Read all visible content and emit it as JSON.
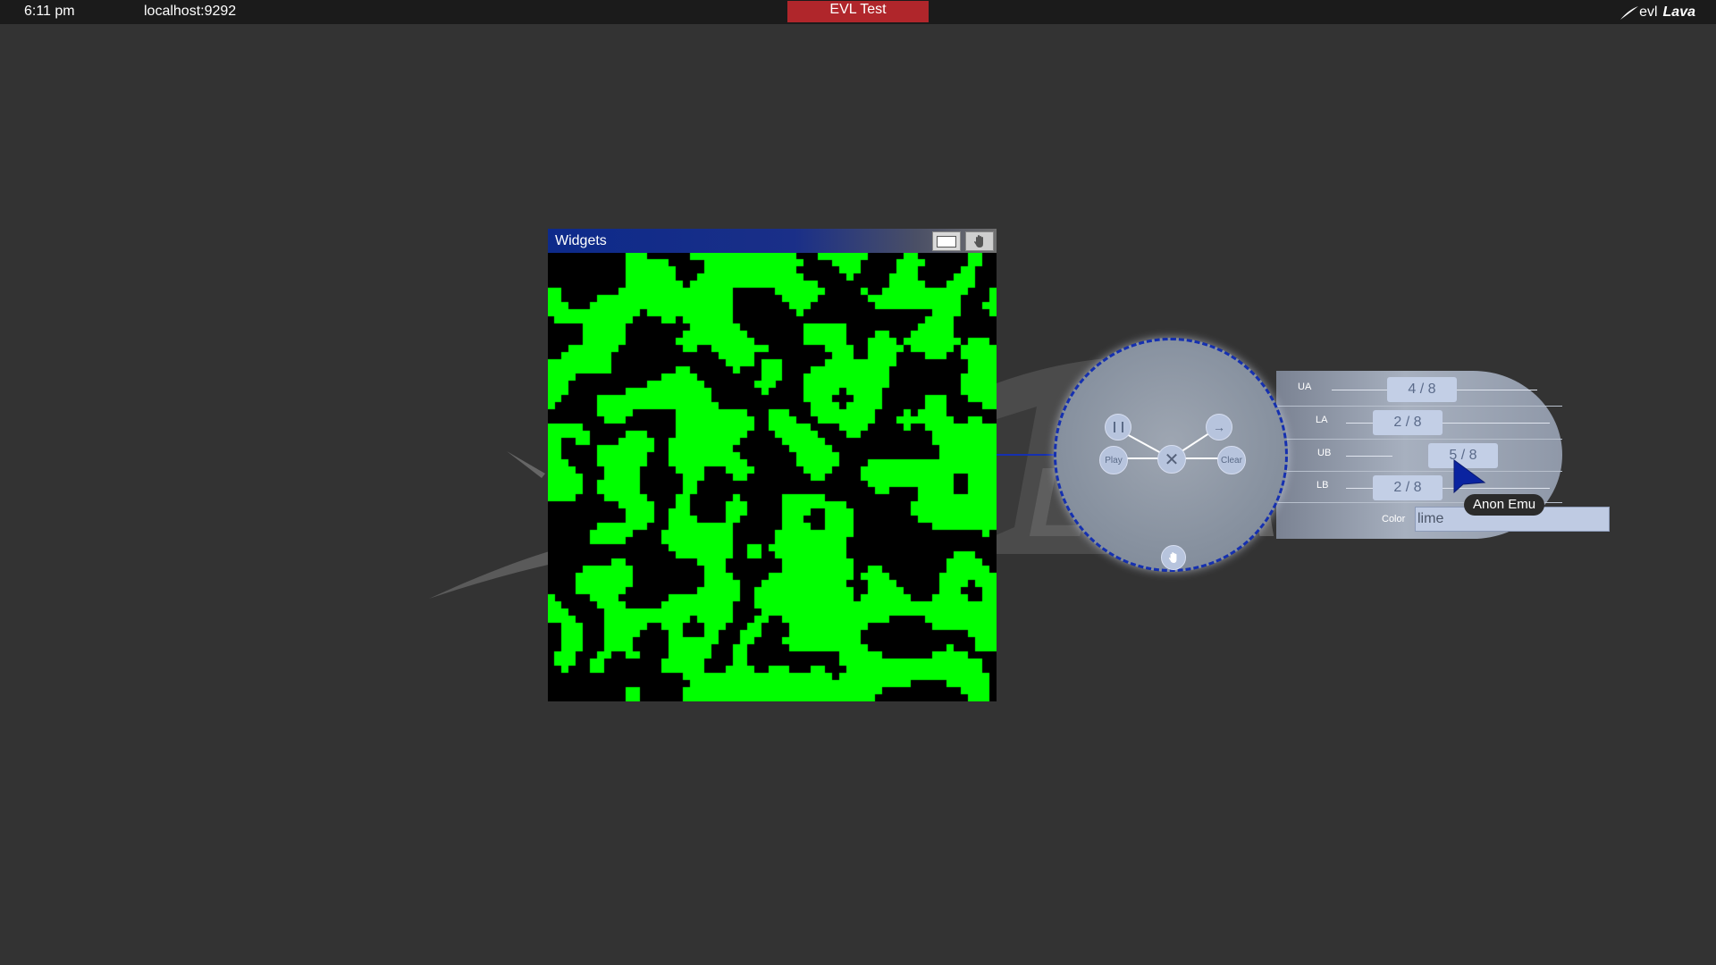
{
  "topbar": {
    "time": "6:11 pm",
    "server": "localhost:9292",
    "site_title": "EVL Test",
    "logo_evl": "evl",
    "logo_lava": "Lava"
  },
  "colors": {
    "topbar_bg": "#1b1b1b",
    "desktop_bg": "#333333",
    "title_badge": "#b0262b",
    "window_titlebar": "#0d2a8a",
    "grid_on": "#00ff00",
    "grid_off": "#000000",
    "radial_border": "#1530b0",
    "pointer": "#0a23a0"
  },
  "window": {
    "title": "Widgets",
    "fullscreen_icon": "fullscreen-icon",
    "sharing_icon": "hand-icon"
  },
  "radial_menu": {
    "pause_icon": "pause-icon",
    "step_icon": "arrow-right-icon",
    "play_label": "Play",
    "clear_label": "Clear",
    "close_icon": "close-icon",
    "drag_icon": "hand-icon"
  },
  "controls": {
    "ua": {
      "label": "UA",
      "value": "4 / 8"
    },
    "la": {
      "label": "LA",
      "value": "2 / 8"
    },
    "ub": {
      "label": "UB",
      "value": "5 / 8"
    },
    "lb": {
      "label": "LB",
      "value": "2 / 8"
    },
    "color": {
      "label": "Color",
      "value": "lime"
    }
  },
  "pointer": {
    "user_name": "Anon Emu"
  },
  "watermark": {
    "text": "LAVA"
  }
}
